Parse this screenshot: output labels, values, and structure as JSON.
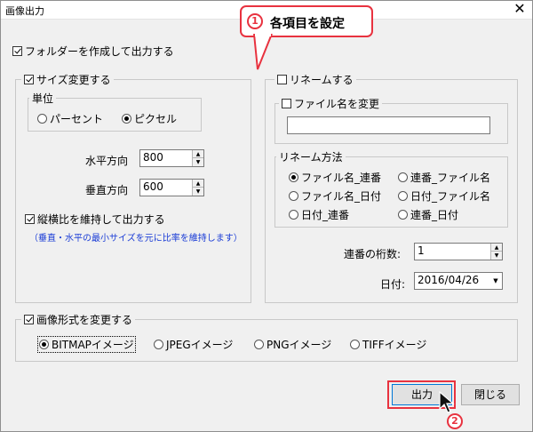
{
  "window": {
    "title": "画像出力"
  },
  "callout": {
    "num": "1",
    "text": "各項目を設定"
  },
  "folder": {
    "label": "フォルダーを作成して出力する",
    "checked": true
  },
  "resize": {
    "label": "サイズ変更する",
    "unit_label": "単位",
    "percent": "パーセント",
    "pixel": "ピクセル",
    "horizontal_label": "水平方向",
    "horizontal_value": "800",
    "vertical_label": "垂直方向",
    "vertical_value": "600",
    "keep_ratio": "縦横比を維持して出力する",
    "note": "（垂直・水平の最小サイズを元に比率を維持します）"
  },
  "rename": {
    "label": "リネームする",
    "filename_label": "ファイル名を変更",
    "filename_value": "",
    "method_label": "リネーム方法",
    "options": [
      "ファイル名_連番",
      "連番_ファイル名",
      "ファイル名_日付",
      "日付_ファイル名",
      "日付_連番",
      "連番_日付"
    ],
    "digits_label": "連番の桁数:",
    "digits_value": "1",
    "date_label": "日付:",
    "date_value": "2016/04/26"
  },
  "format": {
    "label": "画像形式を変更する",
    "options": [
      "BITMAPイメージ",
      "JPEGイメージ",
      "PNGイメージ",
      "TIFFイメージ"
    ]
  },
  "buttons": {
    "output": "出力",
    "close": "閉じる"
  },
  "step2": {
    "num": "2"
  },
  "colors": {
    "accent_red": "#e8323f",
    "note_blue": "#1a3cd6",
    "focus_blue": "#0078d7"
  }
}
